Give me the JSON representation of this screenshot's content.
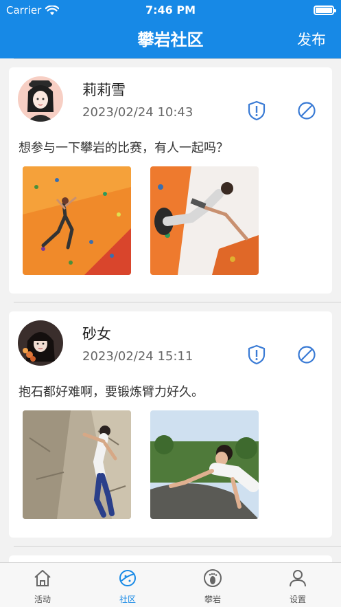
{
  "status_bar": {
    "carrier": "Carrier",
    "time": "7:46 PM"
  },
  "header": {
    "title": "攀岩社区",
    "publish": "发布"
  },
  "posts": [
    {
      "username": "莉莉雪",
      "date": "2023/02/24  10:43",
      "content": "想参与一下攀岩的比赛，有人一起吗？"
    },
    {
      "username": "砂女",
      "date": "2023/02/24  15:11",
      "content": "抱石都好难啊，要锻炼臂力好久。"
    }
  ],
  "tabs": [
    {
      "label": "活动",
      "icon": "home-icon",
      "active": false
    },
    {
      "label": "社区",
      "icon": "planet-icon",
      "active": true
    },
    {
      "label": "攀岩",
      "icon": "footprint-icon",
      "active": false
    },
    {
      "label": "设置",
      "icon": "user-icon",
      "active": false
    }
  ],
  "colors": {
    "accent": "#1789e6",
    "icon_blue": "#3a7bd5"
  }
}
